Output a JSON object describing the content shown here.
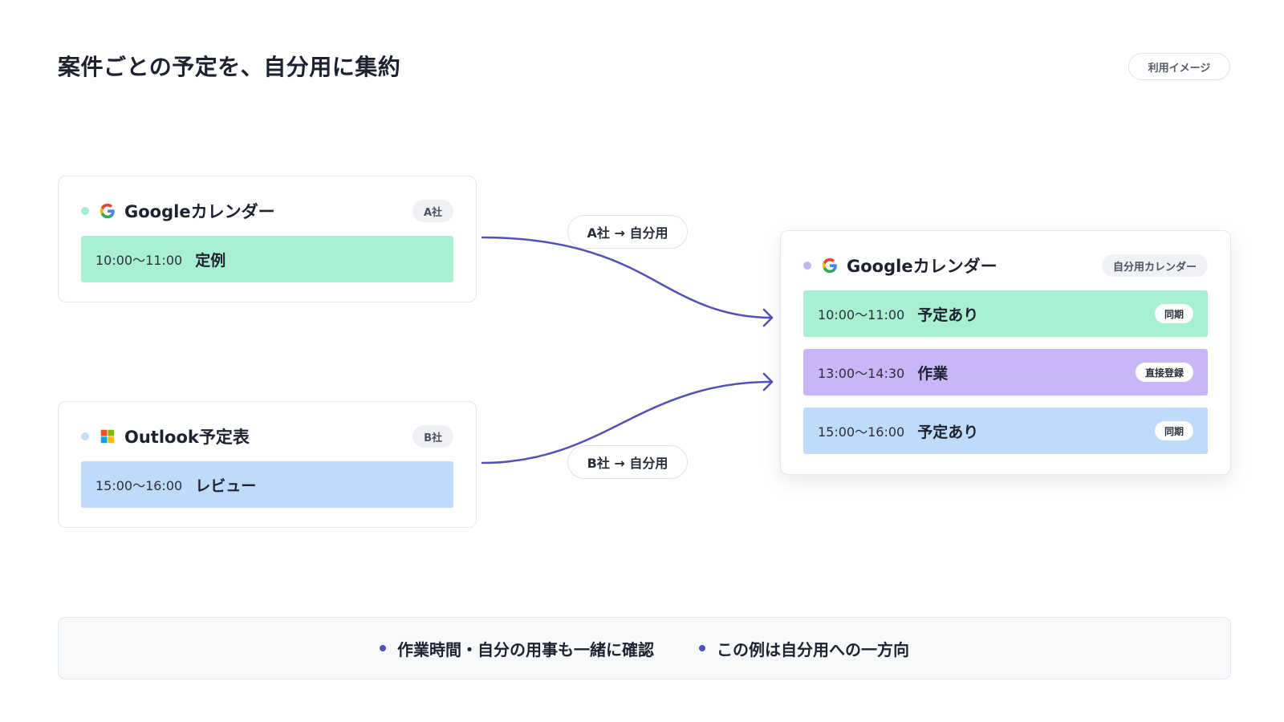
{
  "title": "案件ごとの予定を、自分用に集約",
  "usage_badge": "利用イメージ",
  "sources": [
    {
      "app": "Googleカレンダー",
      "logo": "google-g-icon",
      "tag": "A社",
      "dot_color": "#a7ecd0",
      "event": {
        "time": "10:00〜11:00",
        "title": "定例",
        "color": "#a8f0d1"
      }
    },
    {
      "app": "Outlook予定表",
      "logo": "microsoft-windows-icon",
      "tag": "B社",
      "dot_color": "#c3dcf7",
      "event": {
        "time": "15:00〜16:00",
        "title": "レビュー",
        "color": "#bfdbfb"
      }
    }
  ],
  "flows": [
    {
      "label": "A社 → 自分用"
    },
    {
      "label": "B社 → 自分用"
    }
  ],
  "arrow_color": "#5151b8",
  "destination": {
    "app": "Googleカレンダー",
    "logo": "google-g-icon",
    "tag": "自分用カレンダー",
    "dot_color": "#c6b6f4",
    "events": [
      {
        "time": "10:00〜11:00",
        "title": "予定あり",
        "badge": "同期",
        "color": "#a8f0d1"
      },
      {
        "time": "13:00〜14:30",
        "title": "作業",
        "badge": "直接登録",
        "color": "#c9b6f7"
      },
      {
        "time": "15:00〜16:00",
        "title": "予定あり",
        "badge": "同期",
        "color": "#bfdbfb"
      }
    ]
  },
  "notes": [
    "作業時間・自分の用事も一緒に確認",
    "この例は自分用への一方向"
  ]
}
